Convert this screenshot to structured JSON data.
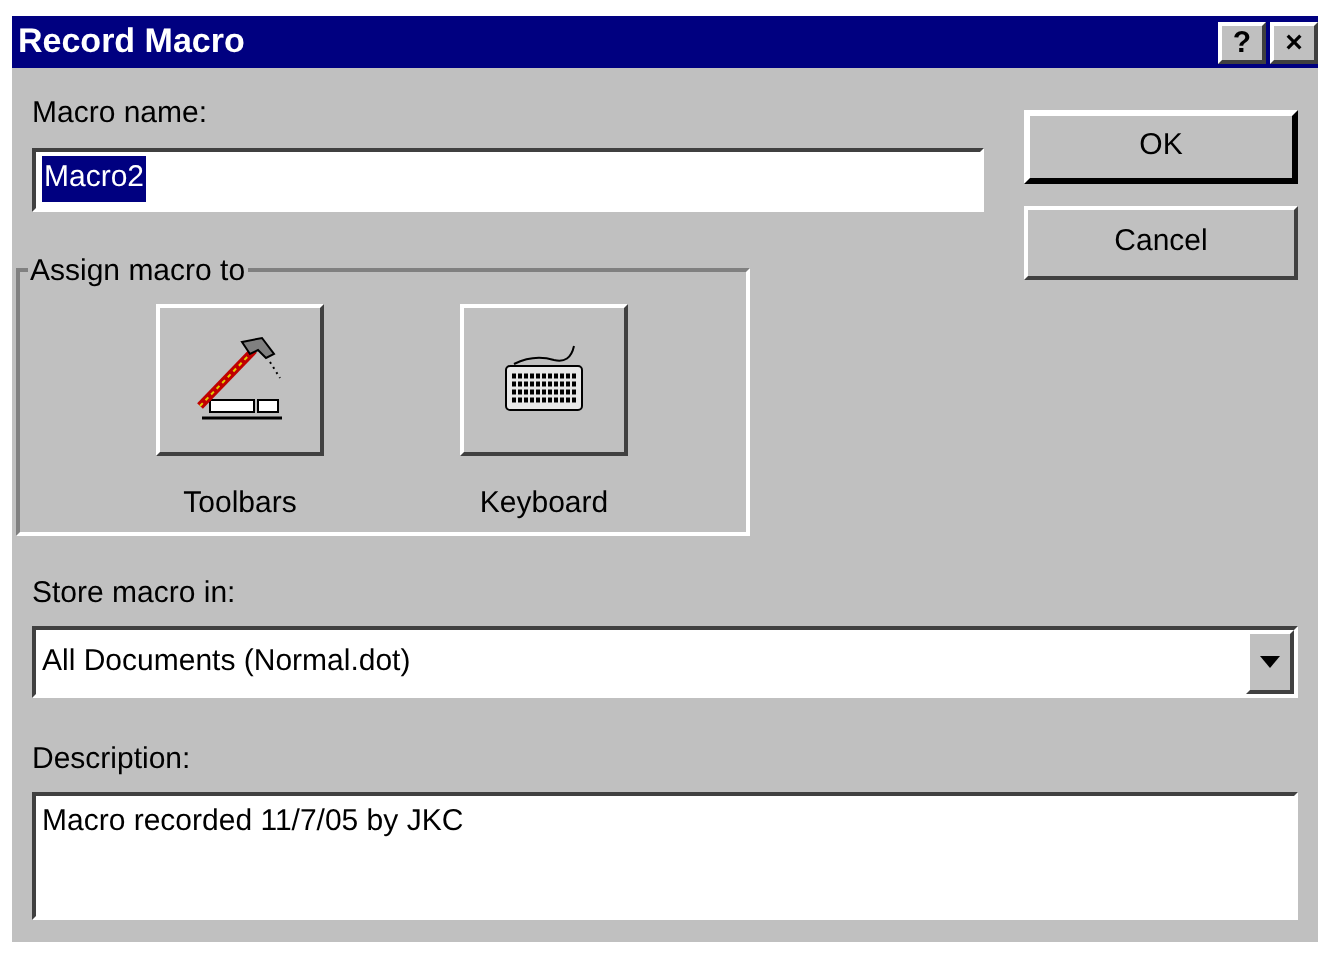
{
  "window": {
    "title": "Record Macro",
    "title_buttons": [
      "?",
      "×"
    ]
  },
  "macro_name": {
    "label": "Macro name:",
    "value": "Macro2",
    "selected": true
  },
  "buttons": [
    "OK",
    "Cancel"
  ],
  "assign": {
    "title": "Assign macro to",
    "targets": [
      {
        "kind": "toolbars",
        "label": "Toolbars"
      },
      {
        "kind": "keyboard",
        "label": "Keyboard"
      }
    ]
  },
  "store": {
    "label": "Store macro in:",
    "value": "All Documents (Normal.dot)"
  },
  "description": {
    "label": "Description:",
    "value": "Macro recorded 11/7/05 by JKC"
  }
}
